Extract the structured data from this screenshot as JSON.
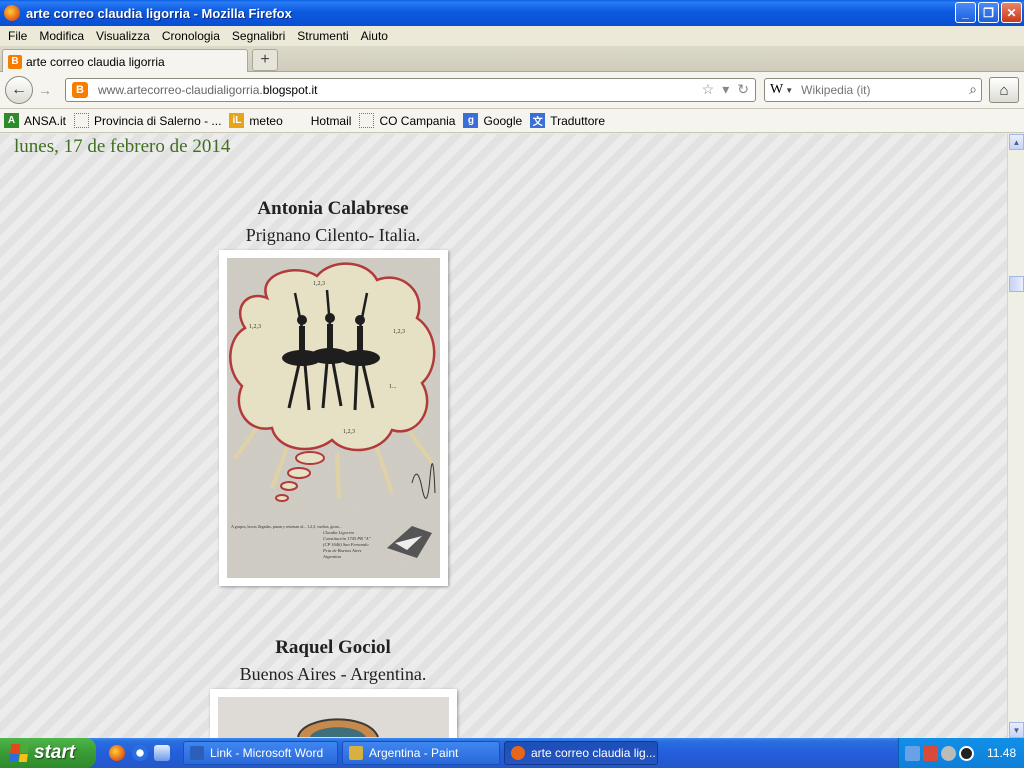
{
  "window": {
    "title": "arte correo claudia ligorria - Mozilla Firefox"
  },
  "menu": [
    "File",
    "Modifica",
    "Visualizza",
    "Cronologia",
    "Segnalibri",
    "Strumenti",
    "Aiuto"
  ],
  "tab": {
    "label": "arte correo claudia ligorria"
  },
  "url": {
    "prefix": "www.artecorreo-claudialigorria.",
    "domain": "blogspot.it"
  },
  "search": {
    "engine_glyph": "W",
    "placeholder": "Wikipedia (it)"
  },
  "bookmarks": [
    {
      "label": "ANSA.it",
      "icon": "ansa-icon",
      "color": "#2c8c2c",
      "glyph": "A"
    },
    {
      "label": "Provincia di Salerno - ...",
      "icon": "blank-page-icon",
      "color": "",
      "glyph": ""
    },
    {
      "label": "meteo",
      "icon": "meteo-icon",
      "color": "#e8a317",
      "glyph": "iL"
    },
    {
      "label": "Hotmail",
      "icon": "windows-flag-icon",
      "color": "#e04a1a",
      "glyph": ""
    },
    {
      "label": "CO Campania",
      "icon": "blank-page-icon",
      "color": "",
      "glyph": ""
    },
    {
      "label": "Google",
      "icon": "google-icon",
      "color": "#3b6fd8",
      "glyph": "g"
    },
    {
      "label": "Traduttore",
      "icon": "translate-icon",
      "color": "#3b6fd8",
      "glyph": "文"
    }
  ],
  "content": {
    "date": "lunes, 17 de febrero de 2014",
    "posts": [
      {
        "name": "Antonia Calabrese",
        "place": "Prignano Cilento- Italia."
      },
      {
        "name": "Raquel Gociol",
        "place": "Buenos Aires - Argentina."
      }
    ],
    "artwork_text": {
      "count_label": "1,2,3",
      "ellipsis_label": "1...",
      "caption_left": "A grupos, bocas llegadas, pasan y retornan al... 1,2,3, vueltas, giran... ",
      "address": [
        "Claudia Ligorria",
        "Constitución 1745 PB \"A\"",
        "(CP 1646) San Fernando",
        "Pcia de Buenos Aires",
        "Argentina"
      ]
    }
  },
  "taskbar": {
    "start": "start",
    "tasks": [
      {
        "label": "Link - Microsoft Word",
        "icon": "word-icon",
        "color": "#2b5fb8"
      },
      {
        "label": "Argentina - Paint",
        "icon": "paint-icon",
        "color": "#d8b040"
      },
      {
        "label": "arte correo claudia lig...",
        "icon": "firefox-icon",
        "color": "#e8661a"
      }
    ],
    "clock": "11.48"
  },
  "colors": {
    "date_green": "#3f6f1e",
    "xp_blue": "#245edb",
    "start_green": "#3a9a35"
  }
}
